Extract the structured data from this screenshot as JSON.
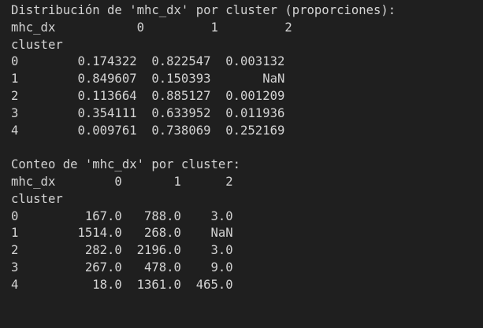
{
  "terminal": {
    "proportions": {
      "title": "Distribución de 'mhc_dx' por cluster (proporciones):",
      "header": "mhc_dx           0         1         2",
      "index_label": "cluster",
      "rows": [
        "0        0.174322  0.822547  0.003132",
        "1        0.849607  0.150393       NaN",
        "2        0.113664  0.885127  0.001209",
        "3        0.354111  0.633952  0.011936",
        "4        0.009761  0.738069  0.252169"
      ]
    },
    "counts": {
      "title": "Conteo de 'mhc_dx' por cluster:",
      "header": "mhc_dx        0       1      2",
      "index_label": "cluster",
      "rows": [
        "0         167.0   788.0    3.0",
        "1        1514.0   268.0    NaN",
        "2         282.0  2196.0    3.0",
        "3         267.0   478.0    9.0",
        "4          18.0  1361.0  465.0"
      ]
    }
  }
}
